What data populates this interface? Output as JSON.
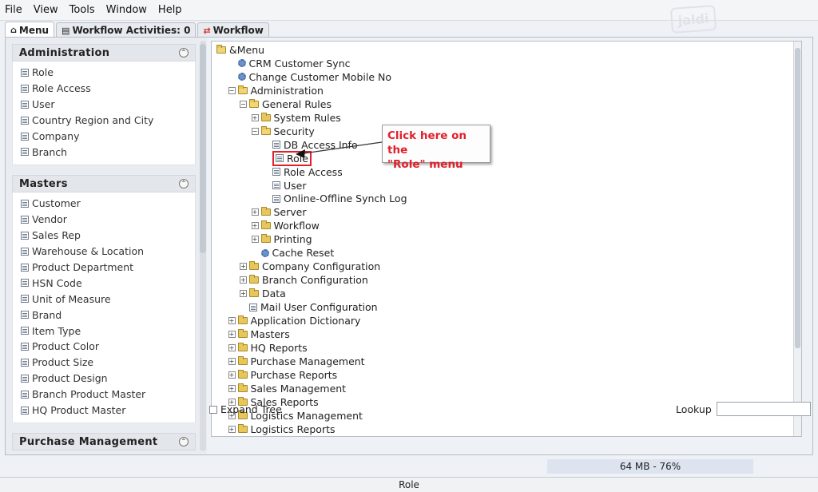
{
  "menubar": {
    "items": [
      "File",
      "View",
      "Tools",
      "Window",
      "Help"
    ],
    "logo_text": "jaldi"
  },
  "tabs": [
    {
      "label": "Menu",
      "icon": "home-icon"
    },
    {
      "label": "Workflow Activities: 0",
      "icon": "document-icon"
    },
    {
      "label": "Workflow",
      "icon": "workflow-icon"
    }
  ],
  "sidebar": {
    "sections": [
      {
        "title": "Administration",
        "items": [
          "Role",
          "Role Access",
          "User",
          "Country Region and City",
          "Company",
          "Branch"
        ]
      },
      {
        "title": "Masters",
        "items": [
          "Customer",
          "Vendor",
          "Sales Rep",
          "Warehouse & Location",
          "Product Department",
          "HSN Code",
          "Unit of Measure",
          "Brand",
          "Item Type",
          "Product Color",
          "Product Size",
          "Product Design",
          "Branch Product Master",
          "HQ Product Master"
        ]
      },
      {
        "title": "Purchase Management",
        "items": []
      }
    ]
  },
  "tree": {
    "rows": [
      {
        "label": "&Menu",
        "type": "folder-open",
        "exp": ""
      },
      {
        "label": "CRM Customer Sync",
        "type": "process",
        "exp": ""
      },
      {
        "label": "Change Customer Mobile No",
        "type": "process",
        "exp": ""
      },
      {
        "label": "Administration",
        "type": "folder-open",
        "exp": "-"
      },
      {
        "label": "General Rules",
        "type": "folder-open",
        "exp": "-"
      },
      {
        "label": "System Rules",
        "type": "folder",
        "exp": "+"
      },
      {
        "label": "Security",
        "type": "folder-open",
        "exp": "-"
      },
      {
        "label": "DB Access Info",
        "type": "window",
        "exp": ""
      },
      {
        "label": "Role",
        "type": "window",
        "exp": "",
        "selected": true
      },
      {
        "label": "Role Access",
        "type": "window",
        "exp": ""
      },
      {
        "label": "User",
        "type": "window",
        "exp": ""
      },
      {
        "label": "Online-Offline Synch Log",
        "type": "window",
        "exp": ""
      },
      {
        "label": "Server",
        "type": "folder",
        "exp": "+"
      },
      {
        "label": "Workflow",
        "type": "folder",
        "exp": "+"
      },
      {
        "label": "Printing",
        "type": "folder",
        "exp": "+"
      },
      {
        "label": "Cache Reset",
        "type": "process",
        "exp": ""
      },
      {
        "label": "Company Configuration",
        "type": "folder",
        "exp": "+"
      },
      {
        "label": "Branch Configuration",
        "type": "folder",
        "exp": "+"
      },
      {
        "label": "Data",
        "type": "folder",
        "exp": "+"
      },
      {
        "label": "Mail User Configuration",
        "type": "window",
        "exp": ""
      },
      {
        "label": "Application Dictionary",
        "type": "folder",
        "exp": "+"
      },
      {
        "label": "Masters",
        "type": "folder",
        "exp": "+"
      },
      {
        "label": "HQ Reports",
        "type": "folder",
        "exp": "+"
      },
      {
        "label": "Purchase Management",
        "type": "folder",
        "exp": "+"
      },
      {
        "label": "Purchase Reports",
        "type": "folder",
        "exp": "+"
      },
      {
        "label": "Sales Management",
        "type": "folder",
        "exp": "+"
      },
      {
        "label": "Sales Reports",
        "type": "folder",
        "exp": "+"
      },
      {
        "label": "Logistics Management",
        "type": "folder",
        "exp": "+"
      },
      {
        "label": "Logistics Reports",
        "type": "folder",
        "exp": "+"
      }
    ]
  },
  "callout": {
    "line1": "Click here on the",
    "line2": "\"Role\" menu"
  },
  "bottom": {
    "expand_tree_label": "Expand Tree",
    "lookup_label": "Lookup",
    "lookup_value": ""
  },
  "memory": "64 MB - 76%",
  "status": "Role",
  "colors": {
    "accent_red": "#e0202a",
    "folder_yellow": "#e8c75a",
    "memory_bg": "#dde4ef"
  }
}
